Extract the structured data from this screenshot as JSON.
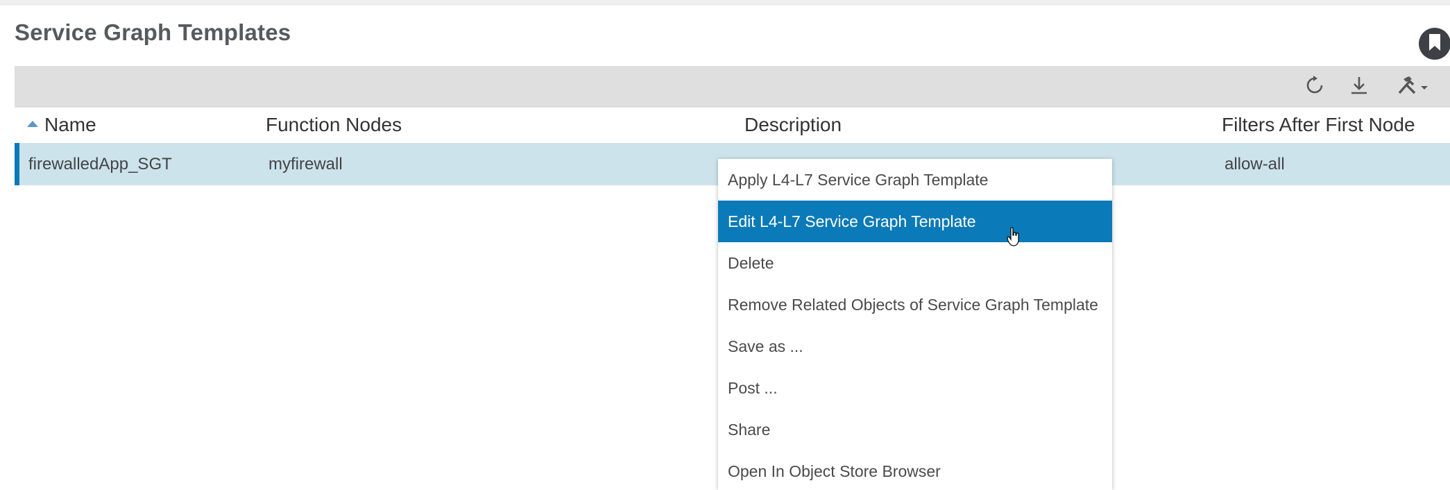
{
  "page": {
    "title": "Service Graph Templates"
  },
  "toolbar": {
    "icons": [
      "refresh-icon",
      "download-icon",
      "tools-icon"
    ]
  },
  "table": {
    "columns": [
      "Name",
      "Function Nodes",
      "Description",
      "Filters After First Node"
    ],
    "sorted_column": "Name",
    "sort_direction": "ascending",
    "rows": [
      {
        "name": "firewalledApp_SGT",
        "function_nodes": "myfirewall",
        "description": "",
        "filters": "allow-all"
      }
    ]
  },
  "context_menu": {
    "items": [
      "Apply L4-L7 Service Graph Template",
      "Edit L4-L7 Service Graph Template",
      "Delete",
      "Remove Related Objects of Service Graph Template",
      "Save as ...",
      "Post ...",
      "Share",
      "Open In Object Store Browser"
    ],
    "highlighted_index": 1
  },
  "colors": {
    "accent": "#0b7ab8",
    "selected_row": "#cce3ec",
    "toolbar_bg": "#dfdfdf"
  }
}
